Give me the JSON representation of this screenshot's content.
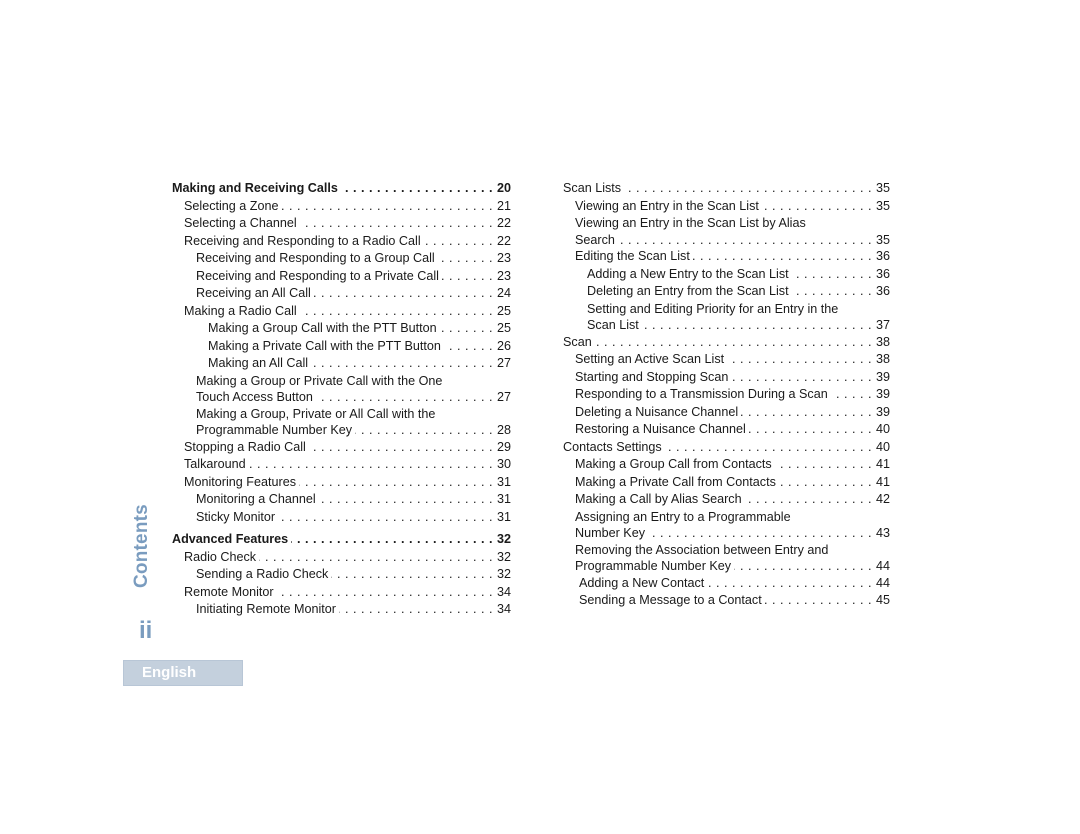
{
  "sidebar": {
    "section_title": "Contents",
    "page_number": "ii",
    "language_tab": "English"
  },
  "toc_left": [
    {
      "title": "Making and Receiving Calls",
      "page": "20",
      "level": 0,
      "bold": true
    },
    {
      "title": "Selecting a Zone",
      "page": "21",
      "level": 1
    },
    {
      "title": "Selecting a Channel",
      "page": "22",
      "level": 1
    },
    {
      "title": "Receiving and Responding to a Radio Call",
      "page": "22",
      "level": 1
    },
    {
      "title": "Receiving and Responding to a Group Call",
      "page": "23",
      "level": 2
    },
    {
      "title": "Receiving and Responding to a Private Call",
      "page": "23",
      "level": 2
    },
    {
      "title": "Receiving an All Call",
      "page": "24",
      "level": 2
    },
    {
      "title": "Making a Radio Call",
      "page": "25",
      "level": 1
    },
    {
      "title": "Making a Group Call with the PTT Button",
      "page": "25",
      "level": 3
    },
    {
      "title": "Making a Private Call with the PTT Button",
      "page": "26",
      "level": 3
    },
    {
      "title": "Making an All Call",
      "page": "27",
      "level": 3
    },
    {
      "title_line1": "Making a Group or Private Call with the One",
      "title": "Touch Access Button",
      "page": "27",
      "level": 2
    },
    {
      "title_line1": "Making a Group, Private or All Call with the",
      "title": "Programmable Number Key",
      "page": "28",
      "level": 2
    },
    {
      "title": "Stopping a Radio Call",
      "page": "29",
      "level": 1
    },
    {
      "title": "Talkaround",
      "page": "30",
      "level": 1
    },
    {
      "title": "Monitoring Features",
      "page": "31",
      "level": 1
    },
    {
      "title": "Monitoring a Channel",
      "page": "31",
      "level": 2
    },
    {
      "title": "Sticky Monitor",
      "page": "31",
      "level": 2
    },
    {
      "title": "Advanced Features",
      "page": "32",
      "level": 0,
      "bold": true
    },
    {
      "title": "Radio Check",
      "page": "32",
      "level": 1
    },
    {
      "title": "Sending a Radio Check",
      "page": "32",
      "level": 2
    },
    {
      "title": "Remote Monitor",
      "page": "34",
      "level": 1
    },
    {
      "title": "Initiating Remote Monitor",
      "page": "34",
      "level": 2
    }
  ],
  "toc_right": [
    {
      "title": "Scan Lists",
      "page": "35",
      "level": 0
    },
    {
      "title": "Viewing an Entry in the Scan List",
      "page": "35",
      "level": 1
    },
    {
      "title_line1": "Viewing an Entry in the Scan List by Alias",
      "title": "Search",
      "page": "35",
      "level": 1
    },
    {
      "title": "Editing the Scan List",
      "page": "36",
      "level": 1
    },
    {
      "title": "Adding a New Entry to the Scan List",
      "page": "36",
      "level": 2
    },
    {
      "title": "Deleting an Entry from the Scan List",
      "page": "36",
      "level": 2
    },
    {
      "title_line1": "Setting and Editing Priority for an Entry in the",
      "title": "Scan List",
      "page": "37",
      "level": 2
    },
    {
      "title": "Scan",
      "page": "38",
      "level": 0
    },
    {
      "title": "Setting an Active Scan List",
      "page": "38",
      "level": 1
    },
    {
      "title": "Starting and Stopping Scan",
      "page": "39",
      "level": 1
    },
    {
      "title": "Responding to a Transmission During a Scan",
      "page": "39",
      "level": 1
    },
    {
      "title": "Deleting a Nuisance Channel",
      "page": "39",
      "level": 1
    },
    {
      "title": "Restoring a Nuisance Channel",
      "page": "40",
      "level": 1
    },
    {
      "title": "Contacts Settings",
      "page": "40",
      "level": 0
    },
    {
      "title": "Making a Group Call from Contacts",
      "page": "41",
      "level": 1
    },
    {
      "title": "Making a Private Call from Contacts",
      "page": "41",
      "level": 1
    },
    {
      "title": "Making a Call by Alias Search",
      "page": "42",
      "level": 1
    },
    {
      "title_line1": "Assigning an Entry to a Programmable",
      "title": "Number Key",
      "page": "43",
      "level": 1
    },
    {
      "title_line1": "Removing the Association between Entry and",
      "title": "Programmable Number Key",
      "page": "44",
      "level": 1
    },
    {
      "title": "Adding a New Contact",
      "page": "44",
      "level": 4
    },
    {
      "title": "Sending a Message to a Contact",
      "page": "45",
      "level": 4
    }
  ]
}
